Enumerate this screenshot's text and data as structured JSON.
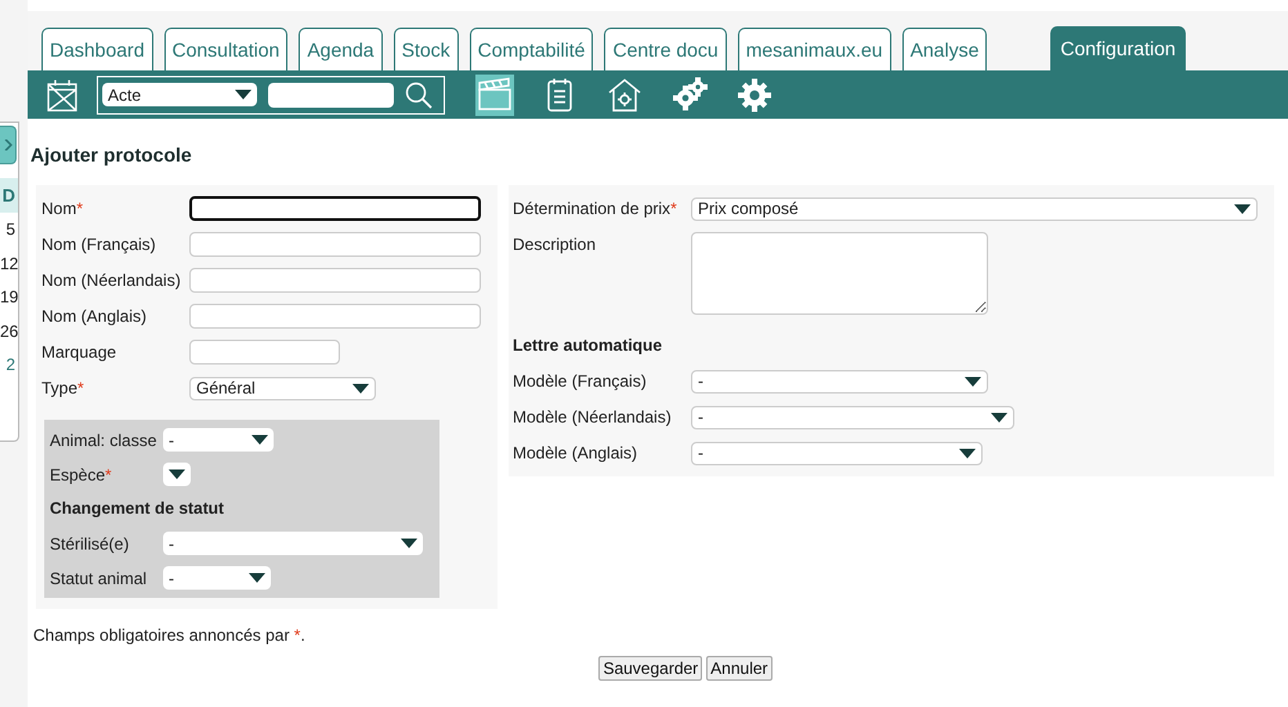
{
  "tabs": [
    {
      "label": "Dashboard",
      "selected": false
    },
    {
      "label": "Consultation",
      "selected": false
    },
    {
      "label": "Agenda",
      "selected": false
    },
    {
      "label": "Stock",
      "selected": false
    },
    {
      "label": "Comptabilité",
      "selected": false
    },
    {
      "label": "Centre docu",
      "selected": false
    },
    {
      "label": "mesanimaux.eu",
      "selected": false
    },
    {
      "label": "Analyse",
      "selected": false
    },
    {
      "label": "Configuration",
      "selected": true
    }
  ],
  "toolbar": {
    "calendar_tool": {
      "selected": false
    },
    "search_select": {
      "value": "Acte"
    },
    "tools": [
      {
        "kind": "clapper",
        "selected": true
      },
      {
        "kind": "clipboard",
        "selected": false
      },
      {
        "kind": "house",
        "selected": false
      },
      {
        "kind": "gears",
        "selected": false
      },
      {
        "kind": "gear",
        "selected": false
      }
    ]
  },
  "sidebar": {
    "header": "D",
    "days": [
      "5",
      "12",
      "19",
      "26",
      "2"
    ]
  },
  "title": "Ajouter protocole",
  "left_fields": [
    {
      "label": "Nom",
      "required_mark": "*",
      "kind": "text",
      "focused": true
    },
    {
      "label": "Nom (Français)",
      "kind": "text",
      "focused": false
    },
    {
      "label": "Nom (Néerlandais)",
      "kind": "text",
      "focused": false
    },
    {
      "label": "Nom (Anglais)",
      "kind": "text",
      "focused": false
    },
    {
      "label": "Marquage",
      "kind": "short",
      "focused": false
    },
    {
      "label": "Type",
      "required_mark": "*",
      "kind": "select",
      "value": "Général"
    }
  ],
  "animal_panel": {
    "fields": [
      {
        "label": "Animal: classe",
        "value": "-"
      },
      {
        "label": "Espèce",
        "required_mark": "*"
      }
    ],
    "heading": "Changement de statut",
    "status_fields": [
      {
        "label": "Stérilisé(e)",
        "value": "-"
      },
      {
        "label": "Statut animal",
        "value": "-"
      }
    ]
  },
  "price": {
    "label": "Détermination de prix",
    "required_mark": "*",
    "value": "Prix composé"
  },
  "description": {
    "label": "Description"
  },
  "letters": {
    "heading": "Lettre automatique",
    "fields": [
      {
        "label": "Modèle (Français)",
        "value": "-"
      },
      {
        "label": "Modèle (Néerlandais)",
        "value": "-"
      },
      {
        "label": "Modèle (Anglais)",
        "value": "-"
      }
    ]
  },
  "footnote": {
    "text": "Champs obligatoires annoncés par ",
    "mark": "*",
    "end": "."
  },
  "buttons": [
    "Sauvegarder",
    "Annuler"
  ]
}
